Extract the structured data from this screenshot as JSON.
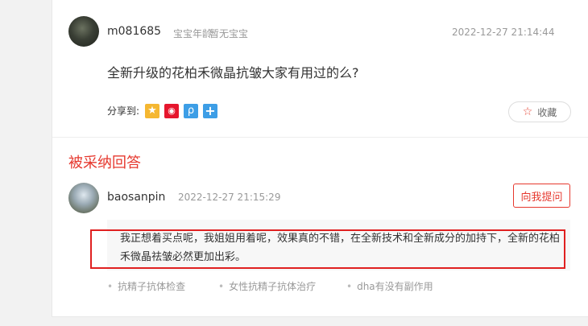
{
  "question": {
    "username": "m081685",
    "baby_age_label": "宝宝年龄",
    "baby_status": "暂无宝宝",
    "time": "2022-12-27 21:14:44",
    "text": "全新升级的花柏禾微晶抗皱大家有用过的么?",
    "share_label": "分享到:",
    "share_icons": [
      "qzone-icon",
      "weibo-icon",
      "tencent-weibo-icon",
      "more-share-icon"
    ],
    "collect_label": "收藏"
  },
  "answer": {
    "section_title": "被采纳回答",
    "username": "baosanpin",
    "time": "2022-12-27 21:15:29",
    "ask_button": "向我提问",
    "text": "我正想着买点呢，我姐姐用着呢，效果真的不错，在全新技术和全新成分的加持下，全新的花柏禾微晶祛皱必然更加出彩。",
    "tags": [
      "抗精子抗体检查",
      "女性抗精子抗体治疗",
      "dha有没有副作用"
    ]
  },
  "colors": {
    "accent": "#e6382e",
    "highlight_border": "#e02020"
  }
}
